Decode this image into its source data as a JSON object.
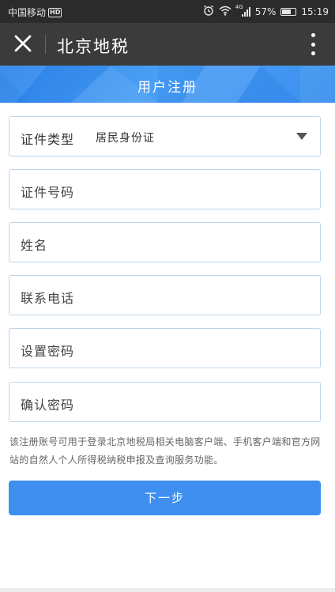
{
  "status_bar": {
    "carrier": "中国移动",
    "network_badge": "HD",
    "network_type": "4G",
    "battery": "57%",
    "time": "15:19",
    "icons": [
      "alarm-icon",
      "wifi-icon",
      "signal-icon",
      "battery-icon"
    ]
  },
  "title_bar": {
    "close_icon": "close-icon",
    "title": "北京地税",
    "more_icon": "more-vertical-icon"
  },
  "banner": {
    "title": "用户注册"
  },
  "form": {
    "id_type": {
      "label": "证件类型",
      "value": "居民身份证"
    },
    "id_number": {
      "placeholder": "证件号码"
    },
    "name": {
      "placeholder": "姓名"
    },
    "phone": {
      "placeholder": "联系电话"
    },
    "password": {
      "placeholder": "设置密码"
    },
    "confirm_password": {
      "placeholder": "确认密码"
    }
  },
  "notice": "该注册账号可用于登录北京地税局相关电脑客户端、手机客户端和官方网站的自然人个人所得税纳税申报及查询服务功能。",
  "next_button": "下一步",
  "colors": {
    "accent": "#3e8ff0",
    "title_bar": "#3b3b3b",
    "status_bar": "#2b2b2b"
  }
}
